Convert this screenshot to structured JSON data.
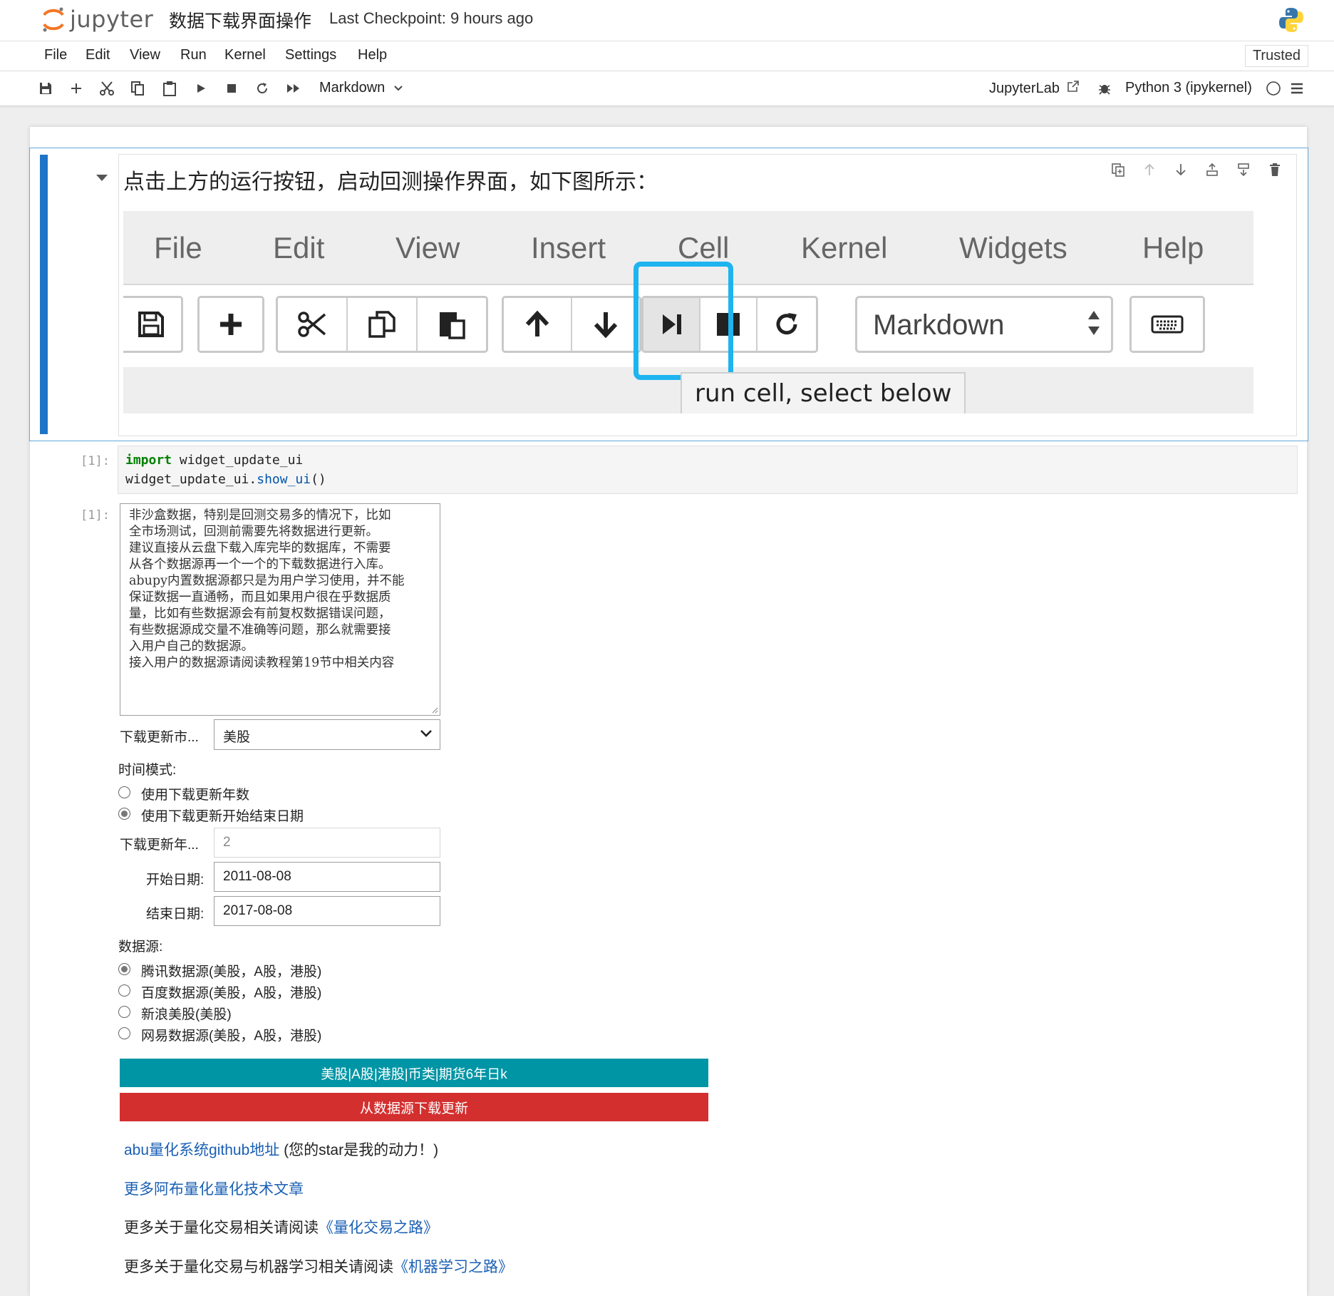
{
  "app": {
    "logo_text": "jupyter",
    "notebook_title": "数据下载界面操作",
    "checkpoint": "Last Checkpoint: 9 hours ago"
  },
  "menu": {
    "items": [
      "File",
      "Edit",
      "View",
      "Run",
      "Kernel",
      "Settings",
      "Help"
    ],
    "trusted": "Trusted"
  },
  "toolbar": {
    "icons": [
      "save-icon",
      "add-icon",
      "cut-icon",
      "copy-icon",
      "paste-icon",
      "run-icon",
      "stop-icon",
      "restart-icon",
      "fast-forward-icon"
    ],
    "cell_type": "Markdown",
    "jupyterlab": "JupyterLab",
    "kernel": "Python 3 (ipykernel)"
  },
  "markdown_cell": {
    "heading": "点击上方的运行按钮，启动回测操作界面，如下图所示：",
    "embedded": {
      "menu": [
        "File",
        "Edit",
        "View",
        "Insert",
        "Cell",
        "Kernel",
        "Widgets",
        "Help"
      ],
      "cell_type": "Markdown",
      "tooltip": "run cell, select below",
      "highlight_color": "#1eb4f0"
    }
  },
  "code_cell": {
    "prompt": "[1]:",
    "line1_kw": "import",
    "line1_rest": " widget_update_ui",
    "line2_obj": "widget_update_ui.",
    "line2_fn": "show_ui",
    "line2_end": "()"
  },
  "output": {
    "prompt": "[1]:",
    "textarea_lines": [
      "非沙盒数据，特别是回测交易多的情况下，比如",
      "全市场测试，回测前需要先将数据进行更新。",
      "建议直接从云盘下载入库完毕的数据库，不需要",
      "从各个数据源再一个一个的下载数据进行入库。",
      "abupy内置数据源都只是为用户学习使用，并不能",
      "保证数据一直通畅，而且如果用户很在乎数据质",
      "量，比如有些数据源会有前复权数据错误问题，",
      "有些数据源成交量不准确等问题，那么就需要接",
      "入用户自己的数据源。",
      "接入用户的数据源请阅读教程第19节中相关内容"
    ],
    "market_label": "下载更新市...",
    "market_value": "美股",
    "time_mode_label": "时间模式:",
    "time_mode_options": [
      "使用下载更新年数",
      "使用下载更新开始结束日期"
    ],
    "time_mode_selected": 1,
    "years_label": "下载更新年...",
    "years_value": "2",
    "start_label": "开始日期:",
    "start_value": "2011-08-08",
    "end_label": "结束日期:",
    "end_value": "2017-08-08",
    "source_label": "数据源:",
    "source_options": [
      "腾讯数据源(美股，A股，港股)",
      "百度数据源(美股，A股，港股)",
      "新浪美股(美股)",
      "网易数据源(美股，A股，港股)"
    ],
    "source_selected": 0,
    "btn_teal": "美股|A股|港股|币类|期货6年日k",
    "btn_red": "从数据源下载更新",
    "teal_color": "#0095a5",
    "red_color": "#d32f2f",
    "link1": "abu量化系统github地址",
    "link1_after": " (您的star是我的动力！)",
    "link2": "更多阿布量化量化技术文章",
    "text3": "更多关于量化交易相关请阅读",
    "link3": "《量化交易之路》",
    "text4": "更多关于量化交易与机器学习相关请阅读",
    "link4": "《机器学习之路》"
  }
}
